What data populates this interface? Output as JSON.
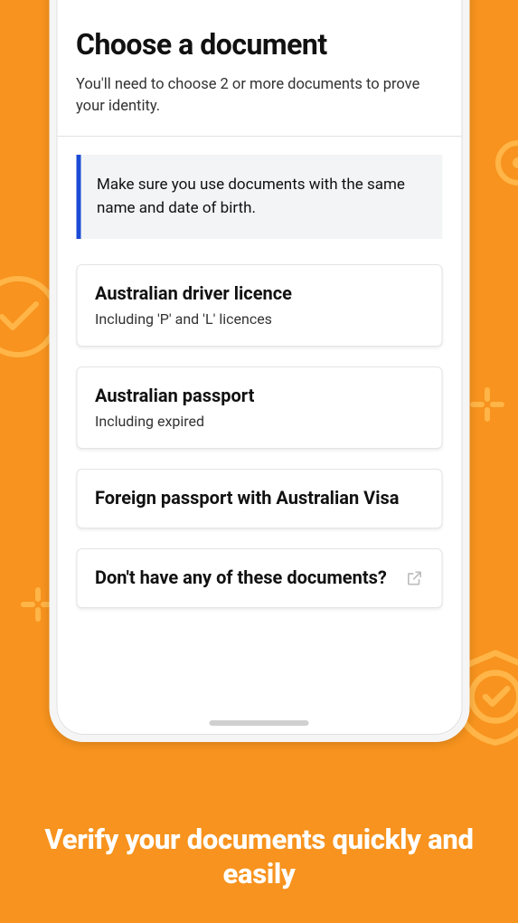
{
  "screen": {
    "title": "Choose a document",
    "subtitle": "You'll need to choose 2 or more documents to prove your identity.",
    "callout": "Make sure you use documents with the same name and date of birth.",
    "docs": [
      {
        "title": "Australian driver licence",
        "sub": "Including 'P' and 'L' licences"
      },
      {
        "title": "Australian passport",
        "sub": "Including expired"
      },
      {
        "title": "Foreign passport with Australian Visa",
        "sub": ""
      },
      {
        "title": "Don't have any of these documents?",
        "sub": "",
        "external": true
      }
    ]
  },
  "tagline": "Verify your documents quickly and easily",
  "colors": {
    "accent_bg": "#f7931e",
    "callout_border": "#1a4bd6",
    "deco": "#ffb547"
  }
}
